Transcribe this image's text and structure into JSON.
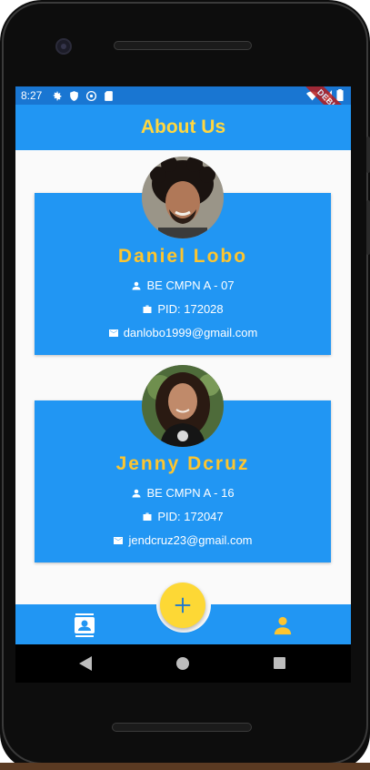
{
  "status": {
    "time": "8:27",
    "debug_label": "DEBUG"
  },
  "app_bar": {
    "title": "About Us"
  },
  "members": [
    {
      "name": "Daniel Lobo",
      "class": "BE CMPN A - 07",
      "pid": "PID: 172028",
      "email": "danlobo1999@gmail.com"
    },
    {
      "name": "Jenny Dcruz",
      "class": "BE CMPN A - 16",
      "pid": "PID: 172047",
      "email": "jendcruz23@gmail.com"
    }
  ],
  "colors": {
    "primary": "#2196f3",
    "status_bar": "#1976d2",
    "accent_yellow": "#fdc52f",
    "fab": "#fdd835",
    "background": "#fafafa"
  },
  "icons": {
    "fab": "add-icon",
    "nav_left": "contacts-icon",
    "nav_right": "person-icon",
    "row_class": "person-icon",
    "row_pid": "briefcase-icon",
    "row_email": "mail-icon"
  }
}
